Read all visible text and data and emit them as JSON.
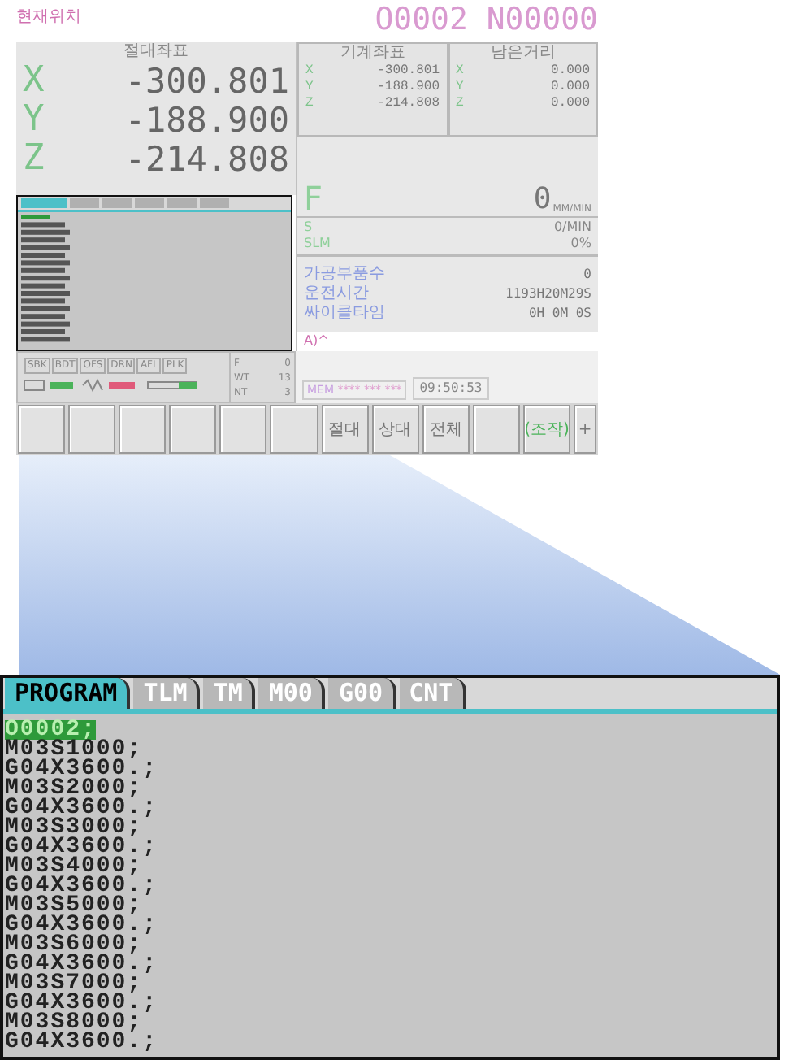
{
  "screen": {
    "title": "현재위치",
    "program_number": "O0002 N00000",
    "absolute": {
      "heading": "절대좌표",
      "axes": [
        {
          "axis": "X",
          "value": "-300.801"
        },
        {
          "axis": "Y",
          "value": "-188.900"
        },
        {
          "axis": "Z",
          "value": "-214.808"
        }
      ]
    },
    "machine": {
      "heading": "기계좌표",
      "axes": [
        {
          "axis": "X",
          "value": "-300.801"
        },
        {
          "axis": "Y",
          "value": "-188.900"
        },
        {
          "axis": "Z",
          "value": "-214.808"
        }
      ]
    },
    "remaining": {
      "heading": "남은거리",
      "axes": [
        {
          "axis": "X",
          "value": "0.000"
        },
        {
          "axis": "Y",
          "value": "0.000"
        },
        {
          "axis": "Z",
          "value": "0.000"
        }
      ]
    },
    "feed": {
      "label": "F",
      "value": "0",
      "unit": "MM/MIN"
    },
    "spindle": [
      {
        "label": "S",
        "value": "0/MIN"
      },
      {
        "label": "SLM",
        "value": "0%"
      }
    ],
    "counters": [
      {
        "label": "가공부품수",
        "value": "0"
      },
      {
        "label": "운전시간",
        "value": "1193H20M29S"
      },
      {
        "label": "싸이클타임",
        "value": "0H 0M 0S"
      }
    ],
    "prompt": "A)^",
    "signals": [
      "SBK",
      "BDT",
      "OFS",
      "DRN",
      "AFL",
      "PLK"
    ],
    "indicators": [
      {
        "label": "F",
        "value": "0"
      },
      {
        "label": "WT",
        "value": "13"
      },
      {
        "label": "NT",
        "value": "3"
      }
    ],
    "status": {
      "mode": "MEM",
      "flags": "**** *** ***",
      "time": "09:50:53"
    },
    "softkeys": [
      {
        "kind": "blank"
      },
      {
        "kind": "blank"
      },
      {
        "kind": "blank"
      },
      {
        "kind": "blank"
      },
      {
        "kind": "blank"
      },
      {
        "kind": "blank"
      },
      {
        "kind": "label",
        "label": "절대"
      },
      {
        "kind": "label",
        "label": "상대"
      },
      {
        "kind": "label",
        "label": "전체"
      },
      {
        "kind": "blank"
      },
      {
        "kind": "operation",
        "label": "(조작)"
      },
      {
        "kind": "next",
        "label": "+"
      }
    ]
  },
  "zoom_view": {
    "tabs": [
      {
        "label": "PROGRAM",
        "selected": true
      },
      {
        "label": "TLM",
        "selected": false
      },
      {
        "label": "TM",
        "selected": false
      },
      {
        "label": "M00",
        "selected": false
      },
      {
        "label": "G00",
        "selected": false
      },
      {
        "label": "CNT",
        "selected": false
      }
    ],
    "lines": [
      {
        "text": "O0002;",
        "selected": true
      },
      {
        "text": "M03S1000;",
        "selected": false
      },
      {
        "text": "G04X3600.;",
        "selected": false
      },
      {
        "text": "M03S2000;",
        "selected": false
      },
      {
        "text": "G04X3600.;",
        "selected": false
      },
      {
        "text": "M03S3000;",
        "selected": false
      },
      {
        "text": "G04X3600.;",
        "selected": false
      },
      {
        "text": "M03S4000;",
        "selected": false
      },
      {
        "text": "G04X3600.;",
        "selected": false
      },
      {
        "text": "M03S5000;",
        "selected": false
      },
      {
        "text": "G04X3600.;",
        "selected": false
      },
      {
        "text": "M03S6000;",
        "selected": false
      },
      {
        "text": "G04X3600.;",
        "selected": false
      },
      {
        "text": "M03S7000;",
        "selected": false
      },
      {
        "text": "G04X3600.;",
        "selected": false
      },
      {
        "text": "M03S8000;",
        "selected": false
      },
      {
        "text": "G04X3600.;",
        "selected": false
      }
    ]
  }
}
